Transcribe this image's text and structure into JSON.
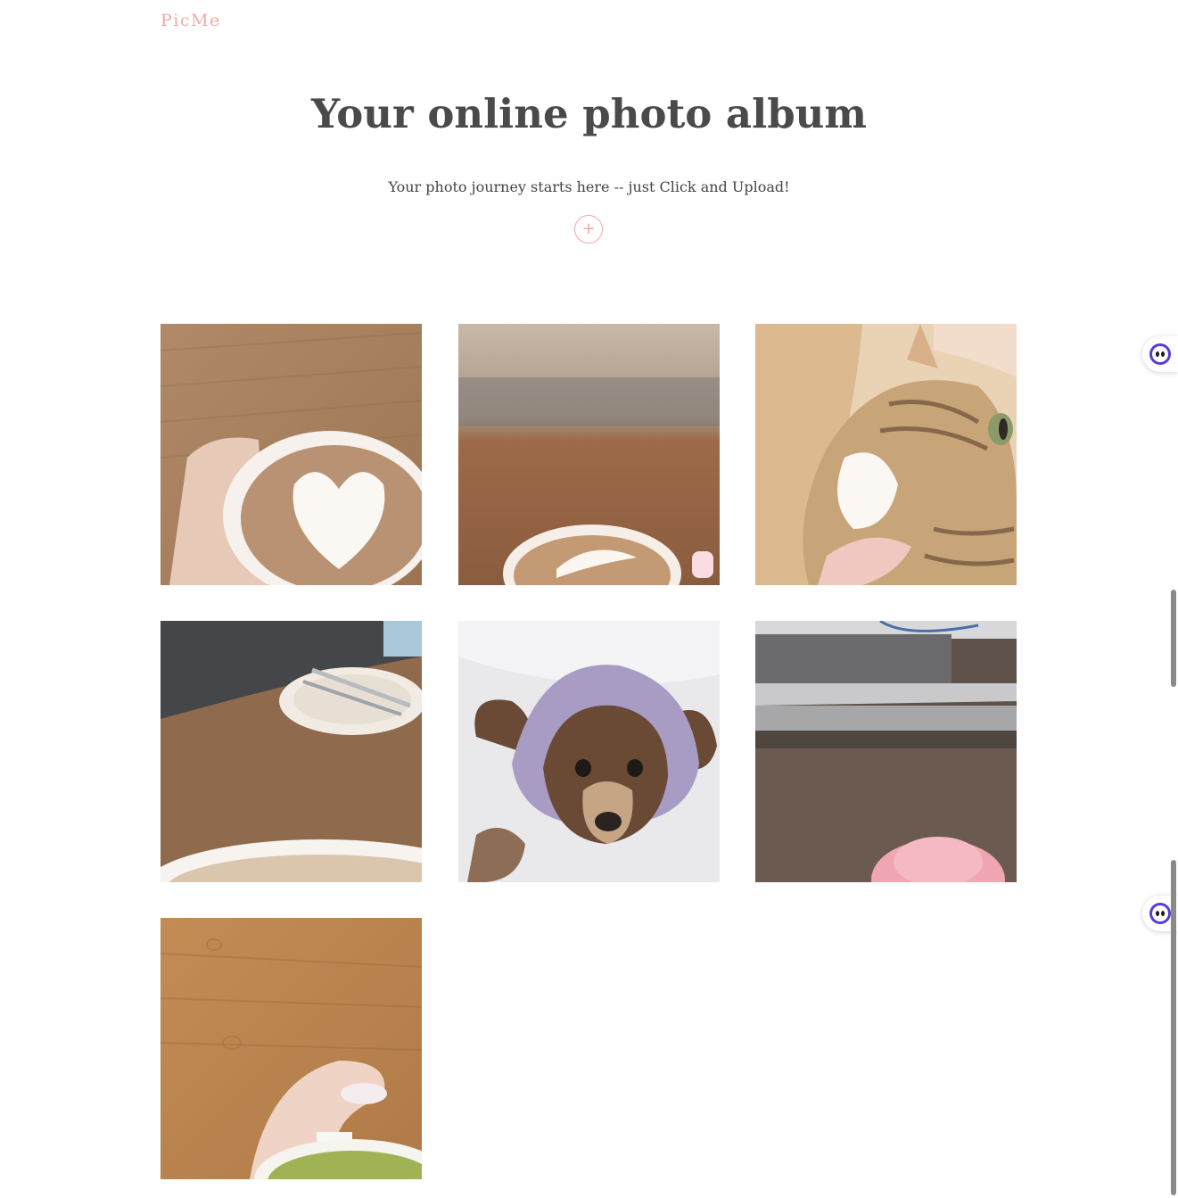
{
  "nav": {
    "brand": "PicMe"
  },
  "hero": {
    "title": "Your online photo album",
    "subtitle": "Your photo journey starts here -- just Click and Upload!",
    "upload_icon": "plus-icon",
    "upload_symbol": "+"
  },
  "colors": {
    "accent": "#f0a9a6",
    "heading": "#4a4a4a",
    "text": "#444444"
  },
  "gallery": {
    "photos": [
      "latte-heart-photo",
      "latte-art-table-photo",
      "tabby-cat-photo",
      "empty-plate-photo",
      "dog-in-bonnet-photo",
      "pink-dessert-counter-photo",
      "matcha-latte-photo"
    ]
  },
  "widgets": {
    "assistant_icon": "assistant-face-icon"
  }
}
